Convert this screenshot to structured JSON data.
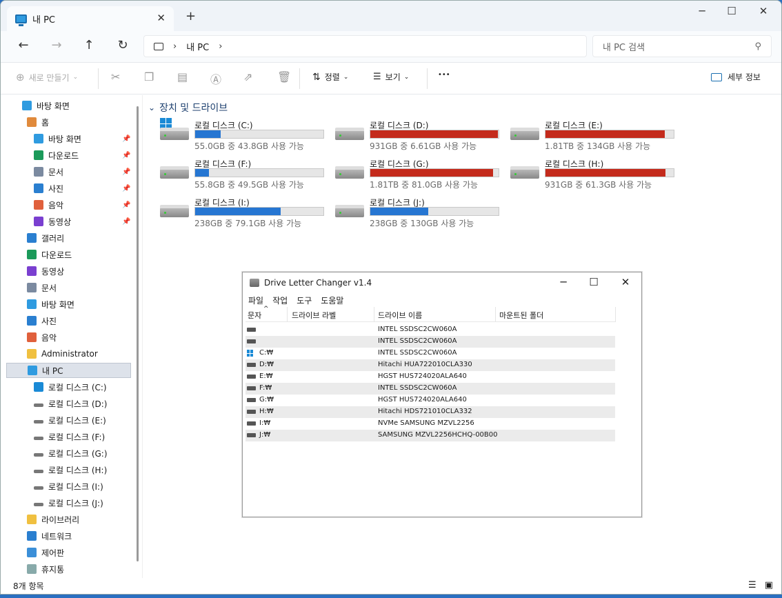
{
  "window": {
    "tab_title": "내 PC",
    "tab_close": "✕",
    "new_tab": "+",
    "minimize": "─",
    "maximize": "☐",
    "close": "✕"
  },
  "address": {
    "back": "←",
    "forward": "→",
    "up": "↑",
    "refresh": "↻",
    "breadcrumb": "내 PC",
    "chevron": "›",
    "search_placeholder": "내 PC 검색"
  },
  "toolbar": {
    "new_label": "새로 만들기",
    "sort_label": "정렬",
    "view_label": "보기",
    "more": "•••",
    "details_label": "세부 정보"
  },
  "sidebar": {
    "items": [
      {
        "label": "바탕 화면",
        "icon": "desktop-icon"
      },
      {
        "label": "홈",
        "icon": "home-icon"
      },
      {
        "label": "바탕 화면",
        "icon": "desktop-icon",
        "pinned": true
      },
      {
        "label": "다운로드",
        "icon": "download-icon",
        "pinned": true
      },
      {
        "label": "문서",
        "icon": "document-icon",
        "pinned": true
      },
      {
        "label": "사진",
        "icon": "pictures-icon",
        "pinned": true
      },
      {
        "label": "음악",
        "icon": "music-icon",
        "pinned": true
      },
      {
        "label": "동영상",
        "icon": "video-icon",
        "pinned": true
      },
      {
        "label": "갤러리",
        "icon": "gallery-icon"
      },
      {
        "label": "다운로드",
        "icon": "download-icon"
      },
      {
        "label": "동영상",
        "icon": "video-icon"
      },
      {
        "label": "문서",
        "icon": "document-icon"
      },
      {
        "label": "바탕 화면",
        "icon": "desktop-icon"
      },
      {
        "label": "사진",
        "icon": "pictures-icon"
      },
      {
        "label": "음악",
        "icon": "music-icon"
      },
      {
        "label": "Administrator",
        "icon": "folder-icon"
      },
      {
        "label": "내 PC",
        "icon": "pc-icon",
        "selected": true
      },
      {
        "label": "로컬 디스크 (C:)",
        "icon": "windows-drive-icon"
      },
      {
        "label": "로컬 디스크 (D:)",
        "icon": "drive-icon"
      },
      {
        "label": "로컬 디스크 (E:)",
        "icon": "drive-icon"
      },
      {
        "label": "로컬 디스크 (F:)",
        "icon": "drive-icon"
      },
      {
        "label": "로컬 디스크 (G:)",
        "icon": "drive-icon"
      },
      {
        "label": "로컬 디스크 (H:)",
        "icon": "drive-icon"
      },
      {
        "label": "로컬 디스크 (I:)",
        "icon": "drive-icon"
      },
      {
        "label": "로컬 디스크 (J:)",
        "icon": "drive-icon"
      },
      {
        "label": "라이브러리",
        "icon": "library-icon"
      },
      {
        "label": "네트워크",
        "icon": "network-icon"
      },
      {
        "label": "제어판",
        "icon": "control-panel-icon"
      },
      {
        "label": "휴지통",
        "icon": "recycle-bin-icon"
      }
    ]
  },
  "main": {
    "section_title": "장치 및 드라이브",
    "drives": [
      {
        "name": "로컬 디스크 (C:)",
        "info": "55.0GB 중 43.8GB 사용 가능",
        "used": 0.2,
        "status": "normal",
        "system": true
      },
      {
        "name": "로컬 디스크 (D:)",
        "info": "931GB 중 6.61GB 사용 가능",
        "used": 0.993,
        "status": "full"
      },
      {
        "name": "로컬 디스크 (E:)",
        "info": "1.81TB 중 134GB 사용 가능",
        "used": 0.93,
        "status": "full"
      },
      {
        "name": "로컬 디스크 (F:)",
        "info": "55.8GB 중 49.5GB 사용 가능",
        "used": 0.11,
        "status": "normal"
      },
      {
        "name": "로컬 디스크 (G:)",
        "info": "1.81TB 중 81.0GB 사용 가능",
        "used": 0.956,
        "status": "full"
      },
      {
        "name": "로컬 디스크 (H:)",
        "info": "931GB 중 61.3GB 사용 가능",
        "used": 0.934,
        "status": "full"
      },
      {
        "name": "로컬 디스크 (I:)",
        "info": "238GB 중 79.1GB 사용 가능",
        "used": 0.668,
        "status": "normal"
      },
      {
        "name": "로컬 디스크 (J:)",
        "info": "238GB 중 130GB 사용 가능",
        "used": 0.454,
        "status": "normal"
      }
    ]
  },
  "status_bar": {
    "count": "8개 항목"
  },
  "dlc": {
    "title": "Drive Letter Changer v1.4",
    "menu": [
      "파일",
      "작업",
      "도구",
      "도움말"
    ],
    "columns": [
      "문자",
      "드라이브 라벨",
      "드라이브 이름",
      "마운트된 폴더"
    ],
    "rows": [
      {
        "letter": "",
        "model": "INTEL SSDSC2CW060A"
      },
      {
        "letter": "",
        "model": "INTEL SSDSC2CW060A"
      },
      {
        "letter": "C:₩",
        "model": "INTEL SSDSC2CW060A",
        "system": true
      },
      {
        "letter": "D:₩",
        "model": "Hitachi HUA722010CLA330"
      },
      {
        "letter": "E:₩",
        "model": "HGST HUS724020ALA640"
      },
      {
        "letter": "F:₩",
        "model": "INTEL SSDSC2CW060A"
      },
      {
        "letter": "G:₩",
        "model": "HGST HUS724020ALA640"
      },
      {
        "letter": "H:₩",
        "model": "Hitachi HDS721010CLA332"
      },
      {
        "letter": "I:₩",
        "model": "NVMe SAMSUNG MZVL2256"
      },
      {
        "letter": "J:₩",
        "model": "SAMSUNG MZVL2256HCHQ-00B00"
      }
    ]
  },
  "colors": {
    "accent": "#2676d2",
    "full": "#c42b1c",
    "selected_bg": "#dde2ea"
  }
}
